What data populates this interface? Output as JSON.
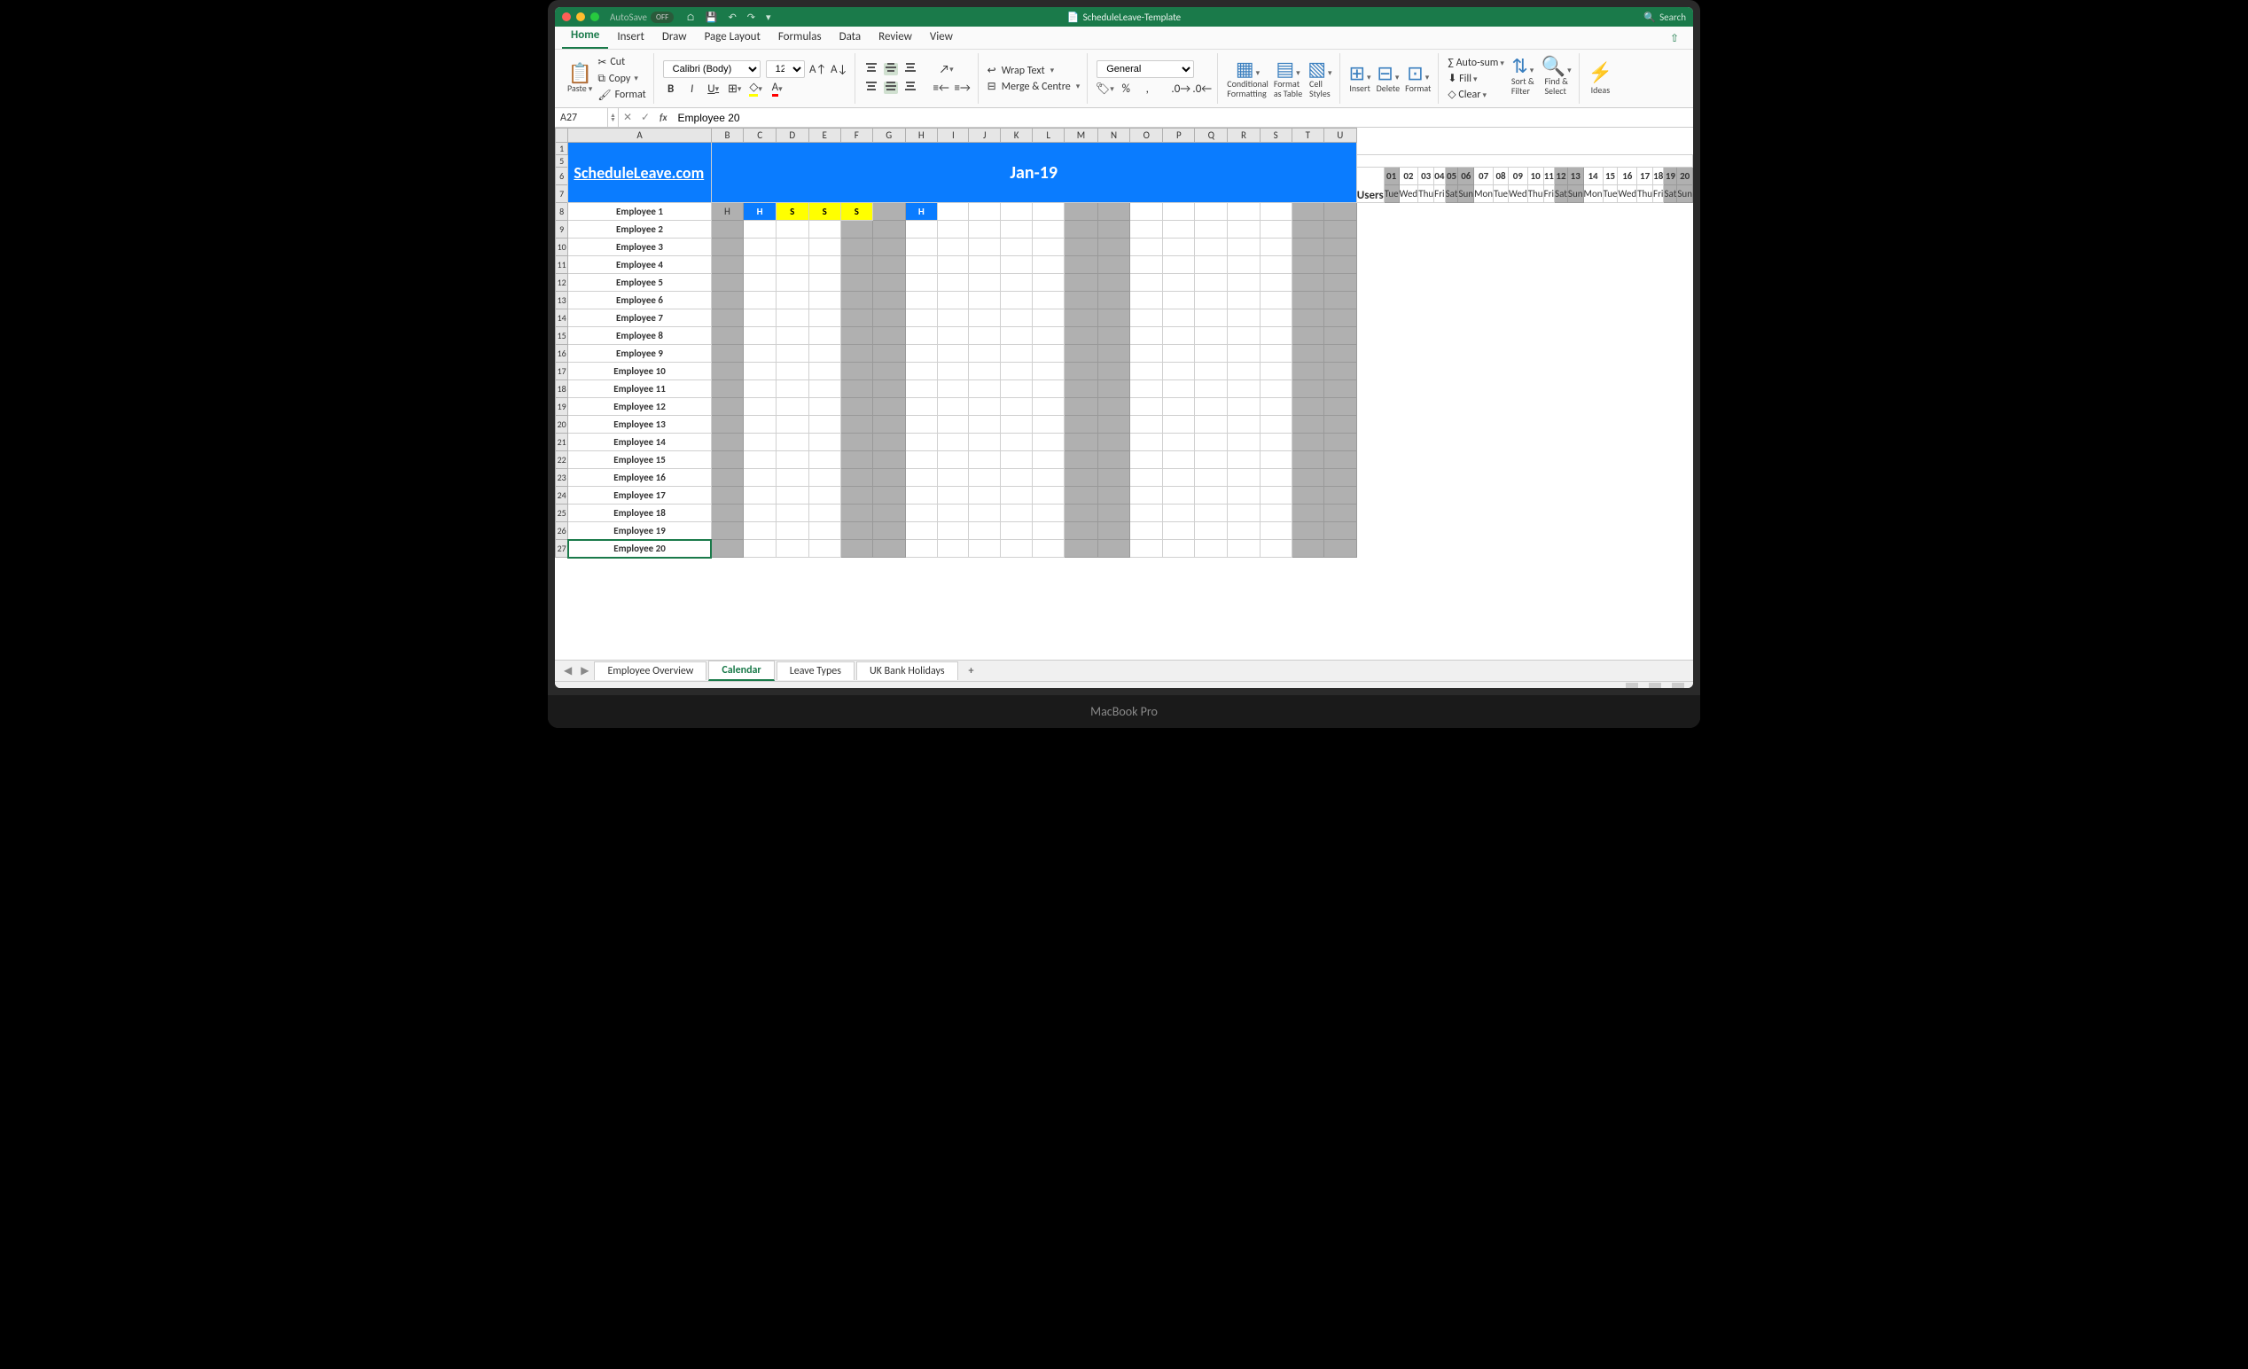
{
  "laptop": "MacBook Pro",
  "window": {
    "autosave": "AutoSave",
    "autosave_state": "OFF",
    "title": "ScheduleLeave-Template",
    "search": "Search"
  },
  "tabs": {
    "home": "Home",
    "insert": "Insert",
    "draw": "Draw",
    "page_layout": "Page Layout",
    "formulas": "Formulas",
    "data": "Data",
    "review": "Review",
    "view": "View"
  },
  "ribbon": {
    "paste": "Paste",
    "cut": "Cut",
    "copy": "Copy",
    "format_painter": "Format",
    "font_name": "Calibri (Body)",
    "font_size": "12",
    "wrap": "Wrap Text",
    "merge": "Merge & Centre",
    "num_format": "General",
    "cond_fmt": "Conditional\nFormatting",
    "fmt_table": "Format\nas Table",
    "cell_styles": "Cell\nStyles",
    "insert": "Insert",
    "delete": "Delete",
    "format": "Format",
    "autosum": "Auto-sum",
    "fill": "Fill",
    "clear": "Clear",
    "sort_filter": "Sort &\nFilter",
    "find_select": "Find &\nSelect",
    "ideas": "Ideas"
  },
  "formula": {
    "cell": "A27",
    "value": "Employee 20"
  },
  "columns": [
    "A",
    "B",
    "C",
    "D",
    "E",
    "F",
    "G",
    "H",
    "I",
    "J",
    "K",
    "L",
    "M",
    "N",
    "O",
    "P",
    "Q",
    "R",
    "S",
    "T",
    "U"
  ],
  "sheet": {
    "site": "ScheduleLeave.com",
    "month": "Jan-19",
    "users_hdr": "Users",
    "days": [
      {
        "num": "01",
        "dow": "Tue",
        "we": false,
        "ph": true
      },
      {
        "num": "02",
        "dow": "Wed",
        "we": false,
        "ph": false
      },
      {
        "num": "03",
        "dow": "Thu",
        "we": false,
        "ph": false
      },
      {
        "num": "04",
        "dow": "Fri",
        "we": false,
        "ph": false
      },
      {
        "num": "05",
        "dow": "Sat",
        "we": true,
        "ph": false
      },
      {
        "num": "06",
        "dow": "Sun",
        "we": true,
        "ph": false
      },
      {
        "num": "07",
        "dow": "Mon",
        "we": false,
        "ph": false
      },
      {
        "num": "08",
        "dow": "Tue",
        "we": false,
        "ph": false
      },
      {
        "num": "09",
        "dow": "Wed",
        "we": false,
        "ph": false
      },
      {
        "num": "10",
        "dow": "Thu",
        "we": false,
        "ph": false
      },
      {
        "num": "11",
        "dow": "Fri",
        "we": false,
        "ph": false
      },
      {
        "num": "12",
        "dow": "Sat",
        "we": true,
        "ph": false
      },
      {
        "num": "13",
        "dow": "Sun",
        "we": true,
        "ph": false
      },
      {
        "num": "14",
        "dow": "Mon",
        "we": false,
        "ph": false
      },
      {
        "num": "15",
        "dow": "Tue",
        "we": false,
        "ph": false
      },
      {
        "num": "16",
        "dow": "Wed",
        "we": false,
        "ph": false
      },
      {
        "num": "17",
        "dow": "Thu",
        "we": false,
        "ph": false
      },
      {
        "num": "18",
        "dow": "Fri",
        "we": false,
        "ph": false
      },
      {
        "num": "19",
        "dow": "Sat",
        "we": true,
        "ph": false
      },
      {
        "num": "20",
        "dow": "Sun",
        "we": true,
        "ph": false
      }
    ],
    "employees": [
      {
        "name": "Employee 1",
        "row": 8,
        "leave": {
          "0": "H",
          "1": "H",
          "2": "S",
          "3": "S",
          "4": "S",
          "6": "H"
        }
      },
      {
        "name": "Employee 2",
        "row": 9,
        "leave": {}
      },
      {
        "name": "Employee 3",
        "row": 10,
        "leave": {}
      },
      {
        "name": "Employee 4",
        "row": 11,
        "leave": {}
      },
      {
        "name": "Employee 5",
        "row": 12,
        "leave": {}
      },
      {
        "name": "Employee 6",
        "row": 13,
        "leave": {}
      },
      {
        "name": "Employee 7",
        "row": 14,
        "leave": {}
      },
      {
        "name": "Employee 8",
        "row": 15,
        "leave": {}
      },
      {
        "name": "Employee 9",
        "row": 16,
        "leave": {}
      },
      {
        "name": "Employee 10",
        "row": 17,
        "leave": {}
      },
      {
        "name": "Employee 11",
        "row": 18,
        "leave": {}
      },
      {
        "name": "Employee 12",
        "row": 19,
        "leave": {}
      },
      {
        "name": "Employee 13",
        "row": 20,
        "leave": {}
      },
      {
        "name": "Employee 14",
        "row": 21,
        "leave": {}
      },
      {
        "name": "Employee 15",
        "row": 22,
        "leave": {}
      },
      {
        "name": "Employee 16",
        "row": 23,
        "leave": {}
      },
      {
        "name": "Employee 17",
        "row": 24,
        "leave": {}
      },
      {
        "name": "Employee 18",
        "row": 25,
        "leave": {}
      },
      {
        "name": "Employee 19",
        "row": 26,
        "leave": {}
      },
      {
        "name": "Employee 20",
        "row": 27,
        "leave": {}
      }
    ]
  },
  "sheets": {
    "s0": "Employee Overview",
    "s1": "Calendar",
    "s2": "Leave Types",
    "s3": "UK Bank Holidays"
  },
  "leave_colors": {
    "H": "h-blue",
    "S": "s-yel"
  }
}
